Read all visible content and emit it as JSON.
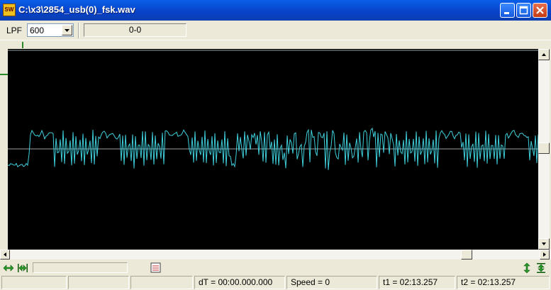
{
  "window": {
    "title": "C:\\x3\\2854_usb(0)_fsk.wav",
    "icon_text": "SW",
    "minimize_icon": "minimize-icon",
    "maximize_icon": "maximize-icon",
    "close_icon": "close-icon"
  },
  "toolbar": {
    "lpf_label": "LPF",
    "lpf_value": "600",
    "range_display": "0-0"
  },
  "waveform": {
    "trace_color": "#3fd0dc",
    "center_line_color": "#9aa0a6",
    "background": "#000000"
  },
  "navigation": {
    "left_icons": [
      "expand-horizontal-icon",
      "contract-horizontal-icon"
    ],
    "marker_icon": "marker-icon",
    "right_icons": [
      "expand-vertical-icon",
      "contract-vertical-icon"
    ]
  },
  "status": {
    "dt": "dT = 00:00.000.000",
    "speed": "Speed = 0",
    "t1": "t1 = 02:13.257",
    "t2": "t2 = 02:13.257"
  }
}
